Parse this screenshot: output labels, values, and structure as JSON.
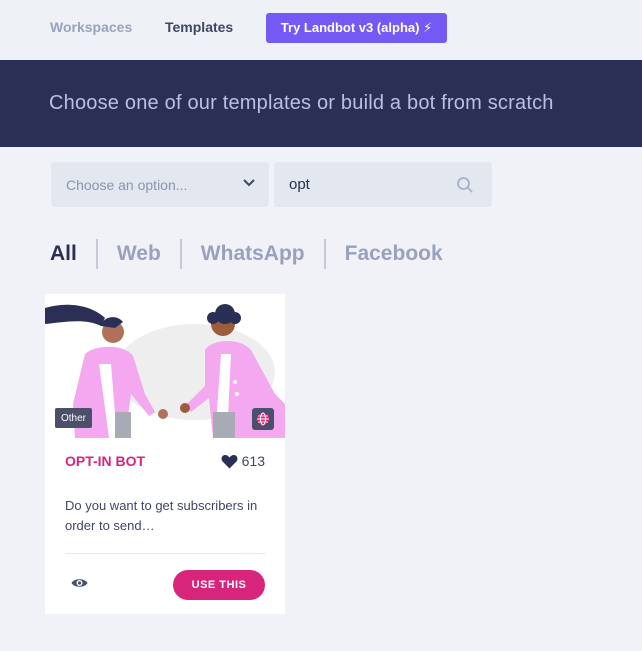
{
  "topnav": {
    "workspaces": "Workspaces",
    "templates": "Templates",
    "try_button": "Try Landbot v3 (alpha) ⚡"
  },
  "banner": {
    "title": "Choose one of our templates or build a bot from scratch"
  },
  "filters": {
    "select_placeholder": "Choose an option...",
    "search_value": "opt"
  },
  "tabs": [
    "All",
    "Web",
    "WhatsApp",
    "Facebook"
  ],
  "cards": [
    {
      "badge": "Other",
      "title": "OPT-IN BOT",
      "likes": "613",
      "description": "Do you want to get subscribers in order to send…",
      "use_button": "USE THIS"
    }
  ],
  "colors": {
    "accent": "#7559f5",
    "brand_pink": "#d8247b",
    "banner": "#2b2f55"
  },
  "icons": [
    "chevron-down-icon",
    "search-icon",
    "heart-icon",
    "eye-icon",
    "globe-icon"
  ]
}
